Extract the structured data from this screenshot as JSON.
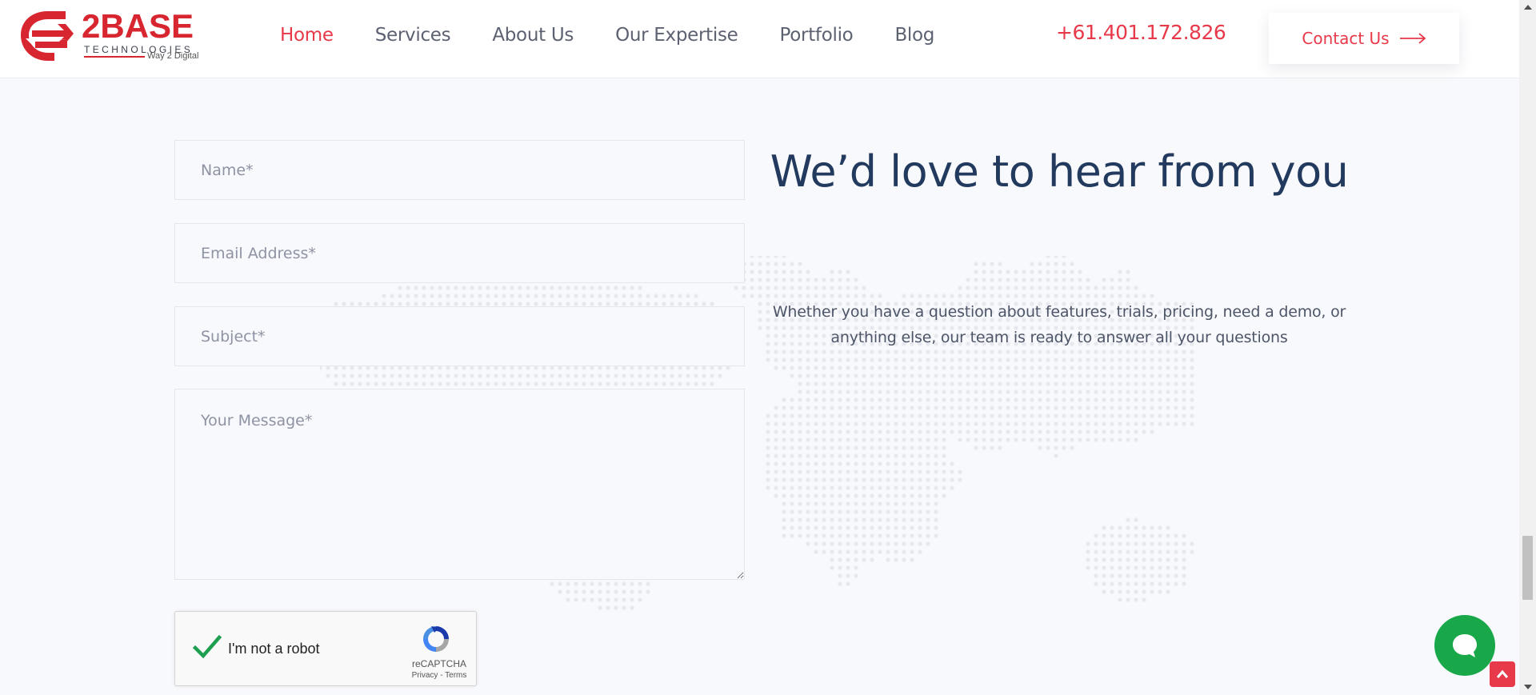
{
  "brand": {
    "name": "2BASE",
    "subtitle": "TECHNOLOGIES",
    "tagline": "Way 2 Digital",
    "accent": "#d7262f"
  },
  "nav": {
    "items": [
      {
        "label": "Home",
        "active": true
      },
      {
        "label": "Services",
        "active": false
      },
      {
        "label": "About Us",
        "active": false
      },
      {
        "label": "Our Expertise",
        "active": false
      },
      {
        "label": "Portfolio",
        "active": false
      },
      {
        "label": "Blog",
        "active": false
      }
    ],
    "phone": "+61.401.172.826",
    "contact_label": "Contact Us",
    "contact_icon": "arrow-right-icon",
    "accent_color": "#e8394a"
  },
  "form": {
    "name_placeholder": "Name*",
    "email_placeholder": "Email Address*",
    "subject_placeholder": "Subject*",
    "message_placeholder": "Your Message*",
    "recaptcha": {
      "label": "I'm not a robot",
      "checked": true,
      "brand": "reCAPTCHA",
      "links": "Privacy - Terms"
    }
  },
  "content": {
    "heading": "We’d love to hear from you",
    "subtext": "Whether you have a question about features, trials, pricing, need a demo, or anything else, our team is ready to answer all your questions",
    "heading_color": "#223a5e"
  },
  "widgets": {
    "chat_icon": "chat-bubble-icon",
    "chat_color": "#18a84a",
    "back_to_top_icon": "chevron-up-icon"
  }
}
